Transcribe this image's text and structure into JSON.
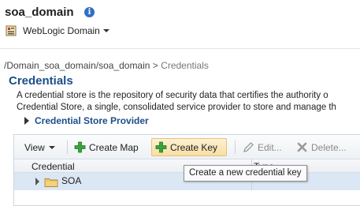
{
  "header": {
    "domain_title": "soa_domain",
    "info_icon_glyph": "i",
    "weblogic_menu_label": "WebLogic Domain"
  },
  "breadcrumb": {
    "path_link": "/Domain_soa_domain/soa_domain",
    "separator": ">",
    "current": "Credentials"
  },
  "page": {
    "title": "Credentials",
    "description_line1": "A credential store is the repository of security data that certifies the authority o",
    "description_line2": "Credential Store, a single, consolidated service provider to store and manage th",
    "provider_label": "Credential Store Provider"
  },
  "toolbar": {
    "view_label": "View",
    "create_map_label": "Create Map",
    "create_key_label": "Create Key",
    "edit_label": "Edit...",
    "delete_label": "Delete..."
  },
  "table": {
    "columns": [
      "Credential",
      "Type"
    ],
    "rows": [
      {
        "name": "SOA",
        "type": ""
      }
    ]
  },
  "tooltip": {
    "text": "Create a new credential key"
  },
  "icons": {
    "info": "info-icon",
    "weblogic_domain": "weblogic-domain-icon",
    "create_map": "plus-green-icon",
    "create_key": "plus-green-icon",
    "edit": "pencil-icon",
    "delete": "x-delete-icon",
    "folder": "folder-icon"
  },
  "colors": {
    "title_blue": "#1b4e8a",
    "info_blue": "#2f6fc6",
    "selected_row": "#dbe7f5",
    "highlight_button": "#f7dea3",
    "plus_green": "#3aa33a"
  }
}
